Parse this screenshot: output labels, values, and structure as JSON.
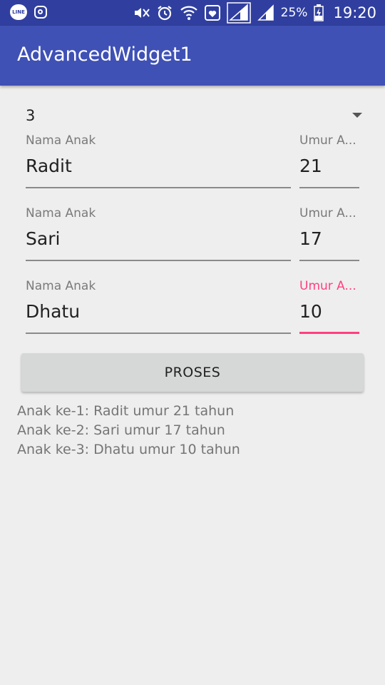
{
  "status_bar": {
    "line_icon_text": "LINE",
    "battery_percent": "25%",
    "time": "19:20"
  },
  "app_bar": {
    "title": "AdvancedWidget1"
  },
  "spinner": {
    "selected_value": "3"
  },
  "children": [
    {
      "name_label": "Nama Anak",
      "name_value": "Radit",
      "age_label": "Umur A...",
      "age_value": "21"
    },
    {
      "name_label": "Nama Anak",
      "name_value": "Sari",
      "age_label": "Umur A...",
      "age_value": "17"
    },
    {
      "name_label": "Nama Anak",
      "name_value": "Dhatu",
      "age_label": "Umur A...",
      "age_value": "10"
    }
  ],
  "button": {
    "label": "PROSES"
  },
  "results": [
    "Anak ke-1: Radit umur 21 tahun",
    "Anak ke-2: Sari umur 17 tahun",
    "Anak ke-3: Dhatu umur 10 tahun"
  ],
  "colors": {
    "primary_dark": "#303f9f",
    "primary": "#3f51b5",
    "accent": "#ff4081",
    "background": "#eeeeee"
  }
}
